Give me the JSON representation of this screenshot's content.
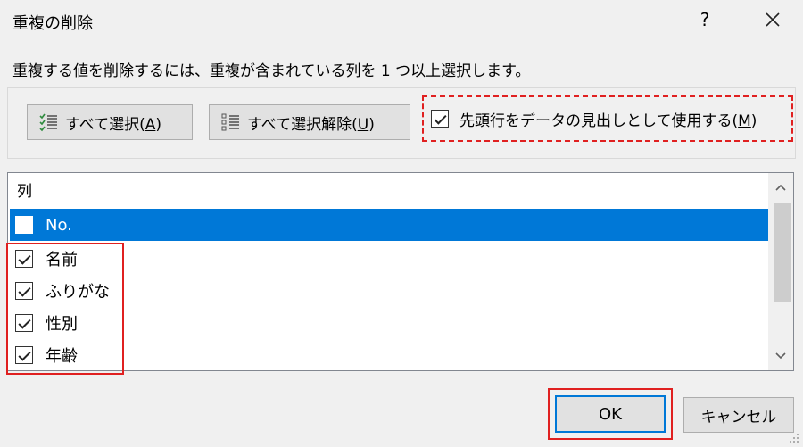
{
  "dialog": {
    "title": "重複の削除",
    "help_label": "?",
    "instruction": "重複する値を削除するには、重複が含まれている列を 1 つ以上選択します。"
  },
  "toolbar": {
    "select_all": {
      "label": "すべて選択(",
      "mnemonic": "A",
      "suffix": ")"
    },
    "unselect_all": {
      "label": "すべて選択解除(",
      "mnemonic": "U",
      "suffix": ")"
    },
    "header_checkbox": {
      "label": "先頭行をデータの見出しとして使用する(",
      "mnemonic": "M",
      "suffix": ")",
      "checked": true
    }
  },
  "columns": {
    "header": "列",
    "items": [
      {
        "label": "No.",
        "checked": false,
        "selected": true
      },
      {
        "label": "名前",
        "checked": true,
        "selected": false
      },
      {
        "label": "ふりがな",
        "checked": true,
        "selected": false
      },
      {
        "label": "性別",
        "checked": true,
        "selected": false
      },
      {
        "label": "年齢",
        "checked": true,
        "selected": false
      }
    ]
  },
  "buttons": {
    "ok": "OK",
    "cancel": "キャンセル"
  },
  "colors": {
    "selection": "#0078d7",
    "highlight": "#e02020",
    "select_icon": "#2e8b3e"
  },
  "icons": {
    "close": "close-icon",
    "select_all": "check-list-icon",
    "unselect_all": "list-icon",
    "scroll_up": "chevron-up-icon",
    "scroll_down": "chevron-down-icon"
  }
}
